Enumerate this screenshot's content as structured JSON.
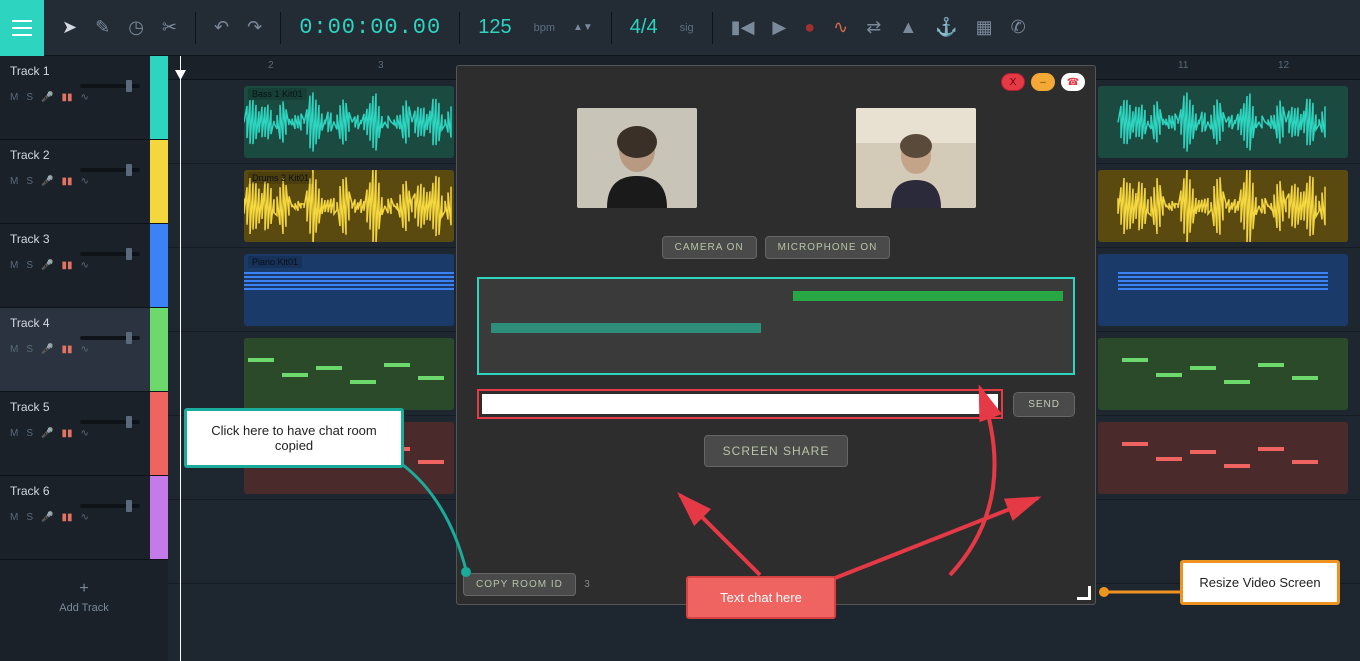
{
  "toolbar": {
    "timecode": "0:00:00.00",
    "bpm_value": "125",
    "bpm_label": "bpm",
    "timesig_value": "4/4",
    "timesig_label": "sig"
  },
  "tracks": [
    {
      "name": "Track 1",
      "color": "#2dd4bf",
      "clip_label": "Bass 1 Kit01",
      "clip_color": "#1a4a40",
      "wave_color": "#2dd4bf"
    },
    {
      "name": "Track 2",
      "color": "#f4d63e",
      "clip_label": "Drums 2 Kit01",
      "clip_color": "#5a4a10",
      "wave_color": "#f4d63e"
    },
    {
      "name": "Track 3",
      "color": "#3b82f6",
      "clip_label": "Piano Kit01",
      "clip_color": "#1a3a6a",
      "wave_color": "#3b82f6"
    },
    {
      "name": "Track 4",
      "color": "#6dd96d",
      "clip_label": "",
      "clip_color": "#2a4a2a",
      "wave_color": "#6dd96d"
    },
    {
      "name": "Track 5",
      "color": "#ef6461",
      "clip_label": "",
      "clip_color": "#4a2a2a",
      "wave_color": "#ef6461"
    },
    {
      "name": "Track 6",
      "color": "#c47ae8",
      "clip_label": "",
      "clip_color": "",
      "wave_color": ""
    }
  ],
  "track_controls": {
    "m": "M",
    "s": "S"
  },
  "add_track_label": "Add Track",
  "ruler_marks": [
    "2",
    "3",
    "11",
    "12"
  ],
  "video_panel": {
    "camera_btn": "CAMERA ON",
    "mic_btn": "MICROPHONE ON",
    "send_btn": "SEND",
    "screen_share_btn": "SCREEN SHARE",
    "copy_room_btn": "COPY ROOM ID",
    "room_suffix": "3"
  },
  "callouts": {
    "copy_room": "Click here to have chat room copied",
    "text_chat": "Text chat here",
    "resize": "Resize Video Screen"
  }
}
